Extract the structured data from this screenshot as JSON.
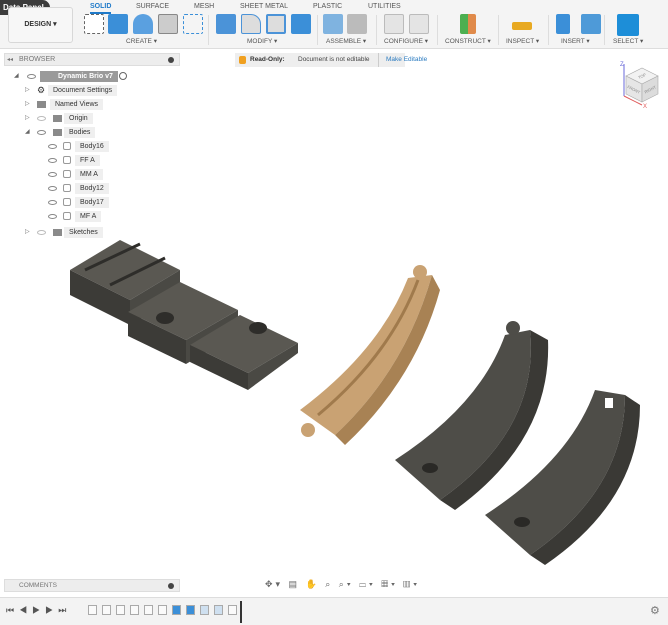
{
  "app": {
    "data_panel": "Data Panel",
    "workspace": "DESIGN ▾"
  },
  "tabs": [
    "SOLID",
    "SURFACE",
    "MESH",
    "SHEET METAL",
    "PLASTIC",
    "UTILITIES"
  ],
  "groups": [
    "CREATE ▾",
    "MODIFY ▾",
    "ASSEMBLE ▾",
    "CONFIGURE ▾",
    "CONSTRUCT ▾",
    "INSPECT ▾",
    "INSERT ▾",
    "SELECT ▾"
  ],
  "browser": {
    "title": "BROWSER",
    "root": "Dynamic Brio v7",
    "items": [
      {
        "label": "Document Settings"
      },
      {
        "label": "Named Views"
      },
      {
        "label": "Origin"
      },
      {
        "label": "Bodies"
      },
      {
        "label": "Body16"
      },
      {
        "label": "FF A"
      },
      {
        "label": "MM A"
      },
      {
        "label": "Body12"
      },
      {
        "label": "Body17"
      },
      {
        "label": "MF A"
      },
      {
        "label": "Sketches"
      }
    ]
  },
  "readonly": {
    "label": "Read-Only:",
    "message": "Document is not editable",
    "action": "Make Editable"
  },
  "viewcube": {
    "faces": [
      "TOP",
      "FRONT",
      "RIGHT"
    ],
    "axes": [
      "Z",
      "X"
    ]
  },
  "comments": {
    "title": "COMMENTS"
  },
  "navbar": {
    "icons": "✥▾ ▤ ✋ ⌕ ⌕▾ ▭▾ ▦▾ ▥▾"
  },
  "timeline": {
    "controls": [
      "⏮",
      "◀",
      "▶",
      "▶",
      "⏭"
    ],
    "features": 11
  },
  "colors": {
    "accent": "#1f7ac9",
    "wood": "#c9a273",
    "track": "#4b4a45"
  }
}
